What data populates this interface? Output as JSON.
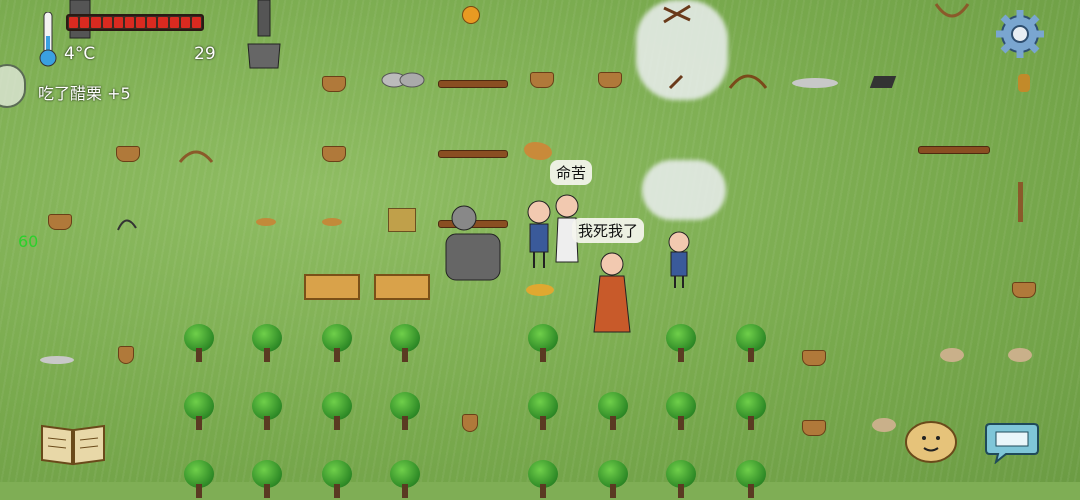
{
  "hud": {
    "temperature": "4°C",
    "food_pips": 12,
    "age": "29",
    "message": "吃了醋栗 +5",
    "fps": "60",
    "thermometer_icon": "thermometer-icon",
    "settings_icon": "gear-icon",
    "tech_book_icon": "book-icon",
    "emote_icon": "potato-face-icon",
    "chat_icon": "keyboard-icon"
  },
  "speech": {
    "bubble_1": "命苦",
    "bubble_2": "我死我了"
  },
  "colors": {
    "grass": "#7fae55",
    "food_bar": "#d92a20",
    "fps_text": "#2bd12b"
  }
}
